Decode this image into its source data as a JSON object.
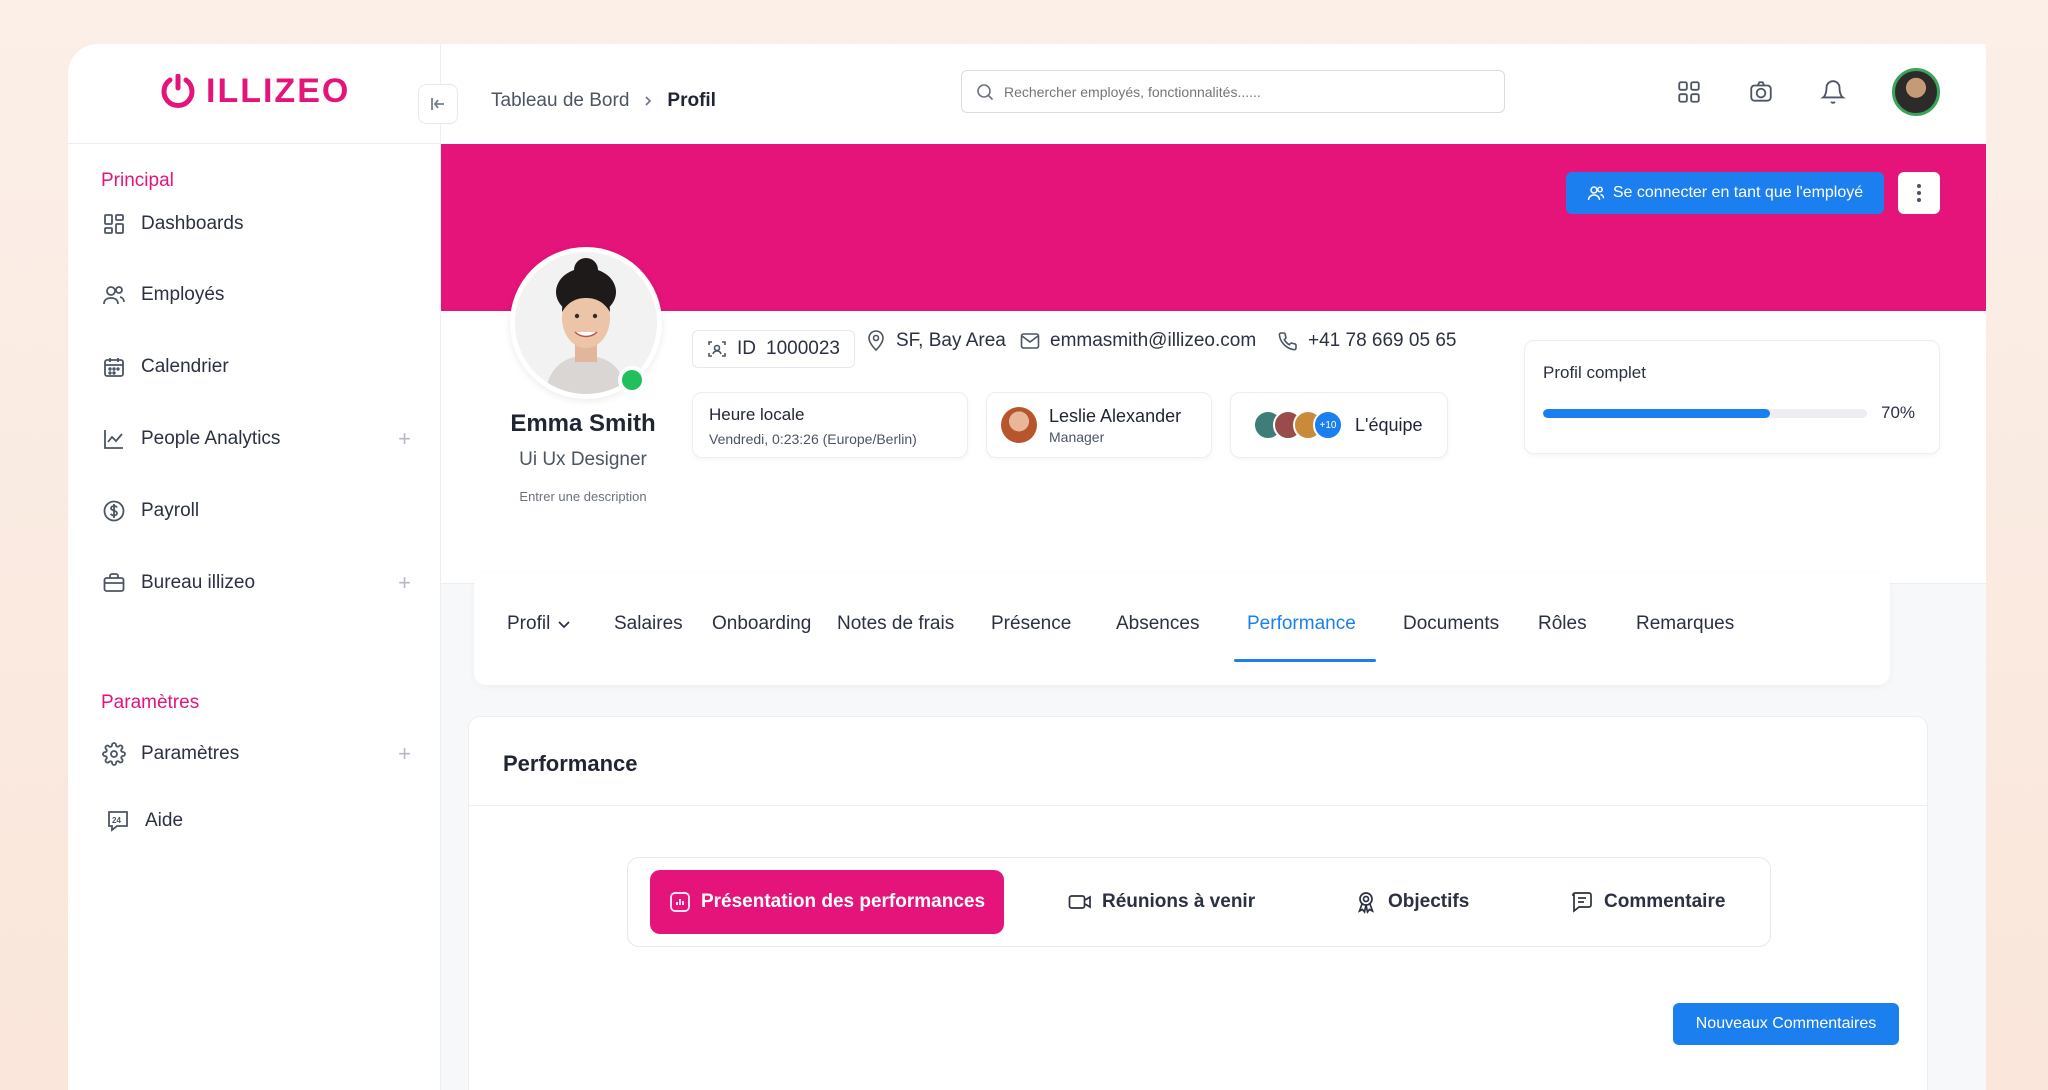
{
  "brand": {
    "name": "ILLIZEO",
    "color": "#e5147a"
  },
  "sidebar": {
    "section_main": "Principal",
    "section_settings": "Paramètres",
    "items": [
      {
        "label": "Dashboards",
        "icon": "grid-icon"
      },
      {
        "label": "Employés",
        "icon": "users-icon"
      },
      {
        "label": "Calendrier",
        "icon": "calendar-icon"
      },
      {
        "label": "People Analytics",
        "icon": "chart-icon",
        "expandable": true
      },
      {
        "label": "Payroll",
        "icon": "dollar-icon"
      },
      {
        "label": "Bureau illizeo",
        "icon": "briefcase-icon",
        "expandable": true
      },
      {
        "label": "Paramètres",
        "icon": "gear-icon",
        "expandable": true
      },
      {
        "label": "Aide",
        "icon": "help-24-icon"
      }
    ]
  },
  "header": {
    "breadcrumb": {
      "root": "Tableau de Bord",
      "current": "Profil"
    },
    "search_placeholder": "Rechercher employés, fonctionnalités......"
  },
  "banner": {
    "connect_label": "Se connecter en tant que l'employé",
    "color": "#e5147a"
  },
  "profile": {
    "name": "Emma Smith",
    "role": "Ui Ux Designer",
    "description_placeholder": "Entrer une description",
    "id_label": "ID",
    "id_value": "1000023",
    "location": "SF, Bay Area",
    "email": "emmasmith@illizeo.com",
    "phone": "+41 78 669 05 65",
    "local_time_title": "Heure locale",
    "local_time_value": "Vendredi, 0:23:26 (Europe/Berlin)",
    "manager_name": "Leslie Alexander",
    "manager_role": "Manager",
    "team_more": "+10",
    "team_label": "L'équipe",
    "completion_title": "Profil complet",
    "completion_percent": 70,
    "completion_label": "70%"
  },
  "tabs": [
    {
      "label": "Profil",
      "dropdown": true
    },
    {
      "label": "Salaires"
    },
    {
      "label": "Onboarding"
    },
    {
      "label": "Notes de frais"
    },
    {
      "label": "Présence"
    },
    {
      "label": "Absences"
    },
    {
      "label": "Performance",
      "active": true
    },
    {
      "label": "Documents"
    },
    {
      "label": "Rôles"
    },
    {
      "label": "Remarques"
    }
  ],
  "performance": {
    "title": "Performance",
    "subtabs": [
      {
        "label": "Présentation des performances",
        "icon": "chart-box-icon",
        "active": true
      },
      {
        "label": "Réunions à venir",
        "icon": "video-icon"
      },
      {
        "label": "Objectifs",
        "icon": "award-icon"
      },
      {
        "label": "Commentaire",
        "icon": "comment-icon"
      }
    ],
    "new_comment_label": "Nouveaux Commentaires"
  },
  "colors": {
    "accent_blue": "#1c7ff0",
    "online": "#22c05a"
  }
}
